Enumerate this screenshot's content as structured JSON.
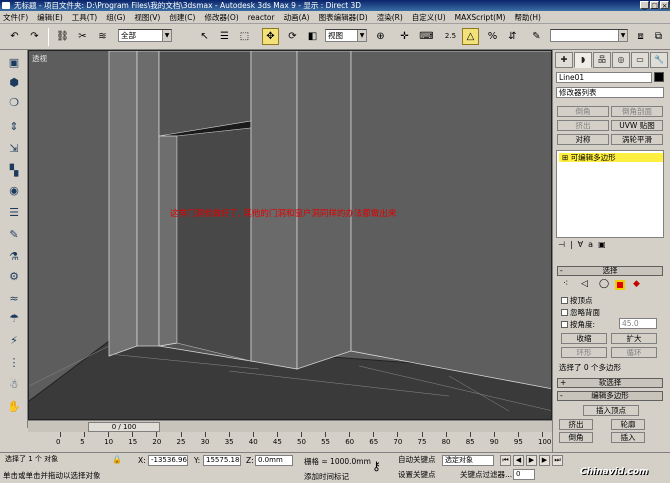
{
  "window": {
    "title": "无标题    - 项目文件夹: D:\\Program Files\\我的文档\\3dsmax    - Autodesk 3ds Max 9    - 显示 : Direct 3D",
    "controls": [
      "_",
      "□",
      "×"
    ]
  },
  "menu": [
    "文件(F)",
    "编辑(E)",
    "工具(T)",
    "组(G)",
    "视图(V)",
    "创建(C)",
    "修改器(O)",
    "reactor",
    "动画(A)",
    "图表编辑器(D)",
    "渲染(R)",
    "自定义(U)",
    "MAXScript(M)",
    "帮助(H)"
  ],
  "toolbar": {
    "selection_filter": "全部",
    "ref_coord": "视图",
    "snap_value": "2.5"
  },
  "viewport": {
    "label": "透视",
    "annotation": "这样门洞就做好了, 其他的门洞和窗户洞同样的办法都做出来"
  },
  "timeline": {
    "slider": "0 / 100",
    "ticks": [
      "0",
      "5",
      "10",
      "15",
      "20",
      "25",
      "30",
      "35",
      "40",
      "45",
      "50",
      "55",
      "60",
      "65",
      "70",
      "75",
      "80",
      "85",
      "90",
      "95",
      "100"
    ]
  },
  "status": {
    "selected": "选择了 1 个 对象",
    "prompt": "单击或单击并拖动以选择对象",
    "x_label": "X:",
    "x_value": "-13536.96",
    "y_label": "Y:",
    "y_value": "15575.186",
    "z_label": "Z:",
    "z_value": "0.0mm",
    "grid": "栅格 = 1000.0mm",
    "add_time_tag": "添加时间标记",
    "auto_key": "自动关键点",
    "set_key": "设置关键点",
    "selected_obj": "选定对象",
    "key_filters": "关键点过滤器...",
    "frame": "0",
    "watermark": "Chinavid.com"
  },
  "panel": {
    "tabs": [
      "✚",
      "◗",
      "品",
      "◎",
      "▭",
      "🔧"
    ],
    "object_name": "Line01",
    "modifier_list": "修改器列表",
    "mod_buttons": [
      {
        "label": "倒角",
        "dim": true
      },
      {
        "label": "倒角剖面",
        "dim": true
      },
      {
        "label": "挤出",
        "dim": true
      },
      {
        "label": "UVW 贴图",
        "dim": false
      },
      {
        "label": "对称",
        "dim": false
      },
      {
        "label": "涡轮平滑",
        "dim": false
      }
    ],
    "stack_item": "可编辑多边形",
    "stack_icons": [
      "⊣",
      "|",
      "∀",
      "a",
      "▣"
    ],
    "select_rollout": "选择",
    "cb_vertex": "按顶点",
    "cb_backface": "忽略背面",
    "cb_angle": "按角度:",
    "angle_value": "45.0",
    "shrink": "收缩",
    "grow": "扩大",
    "ring": "环形",
    "loop": "循环",
    "select_count": "选择了 0 个多边形",
    "soft_select": "软选择",
    "edit_poly": "编辑多边形",
    "insert_vertex": "插入顶点",
    "extrude": "挤出",
    "outline": "轮廓",
    "bevel": "倒角",
    "inset": "插入"
  }
}
